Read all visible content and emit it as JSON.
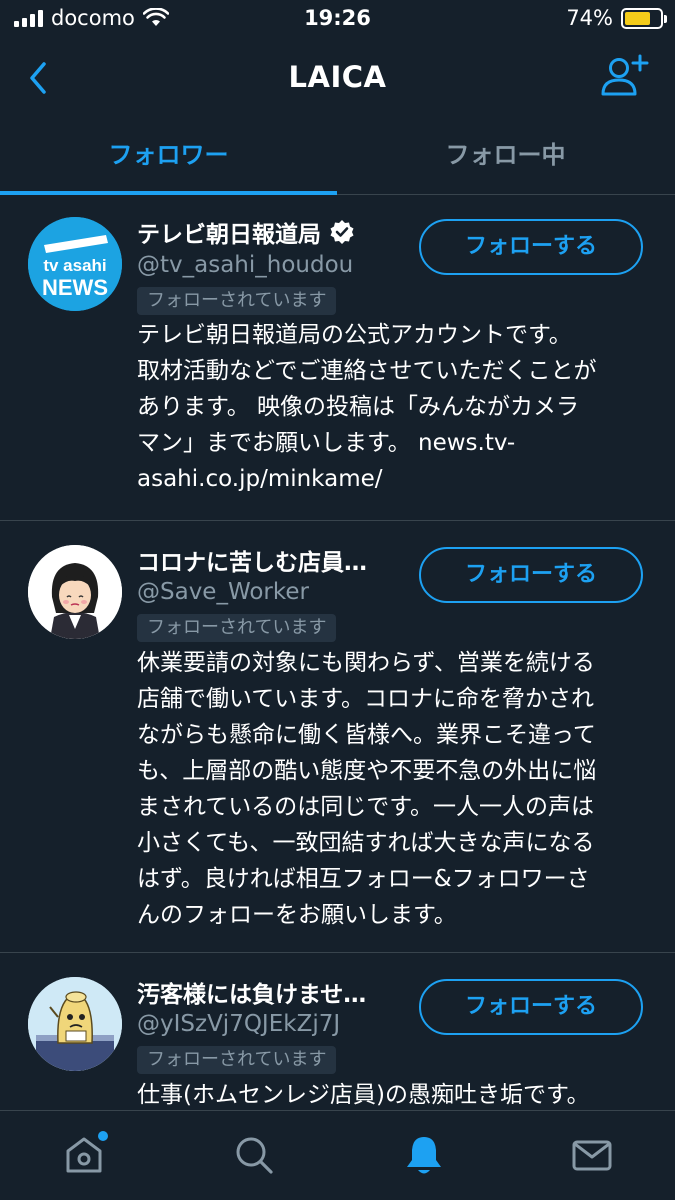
{
  "status_bar": {
    "carrier": "docomo",
    "time": "19:26",
    "battery_percent": "74%",
    "battery_level": 0.74,
    "battery_color": "#f4cc1a"
  },
  "nav": {
    "title": "LAICA",
    "back_icon": "chevron-left-icon",
    "add_icon": "add-user-icon"
  },
  "tabs": [
    {
      "label": "フォロワー",
      "active": true
    },
    {
      "label": "フォロー中",
      "active": false
    }
  ],
  "users": [
    {
      "name": "テレビ朝日報道局",
      "verified": true,
      "handle": "@tv_asahi_houdou",
      "badge": "フォローされています",
      "follow_label": "フォローする",
      "avatar_text_1": "tv asahi",
      "avatar_text_2": "NEWS",
      "bio": [
        "テレビ朝日報道局の公式アカウントです。",
        "取材活動などでご連絡させていただくことが",
        "あります。 映像の投稿は「みんながカメラ",
        "マン」までお願いします。 news.tv-",
        "asahi.co.jp/minkame/"
      ]
    },
    {
      "name": "コロナに苦しむ店員…",
      "verified": false,
      "handle": "@Save_Worker",
      "badge": "フォローされています",
      "follow_label": "フォローする",
      "bio": [
        "休業要請の対象にも関わらず、営業を続ける",
        "店舗で働いています。コロナに命を脅かされ",
        "ながらも懸命に働く皆様へ。業界こそ違って",
        "も、上層部の酷い態度や不要不急の外出に悩",
        "まされているのは同じです。一人一人の声は",
        "小さくても、一致団結すれば大きな声になる",
        "はず。良ければ相互フォロー&フォロワーさ",
        "んのフォローをお願いします。"
      ]
    },
    {
      "name": "汚客様には負けませ…",
      "verified": false,
      "handle": "@yISzVj7QJEkZj7J",
      "badge": "フォローされています",
      "follow_label": "フォローする",
      "bio": [
        "仕事(ホムセンレジ店員)の愚痴吐き垢です。"
      ]
    }
  ],
  "bottom_tabs": [
    {
      "icon": "home-icon",
      "has_dot": true
    },
    {
      "icon": "search-icon",
      "has_dot": false
    },
    {
      "icon": "bell-icon",
      "active": true
    },
    {
      "icon": "mail-icon",
      "has_dot": false
    }
  ],
  "colors": {
    "background": "#15202b",
    "accent": "#1da1f2",
    "muted": "#8899a6",
    "divider": "#38444d"
  }
}
